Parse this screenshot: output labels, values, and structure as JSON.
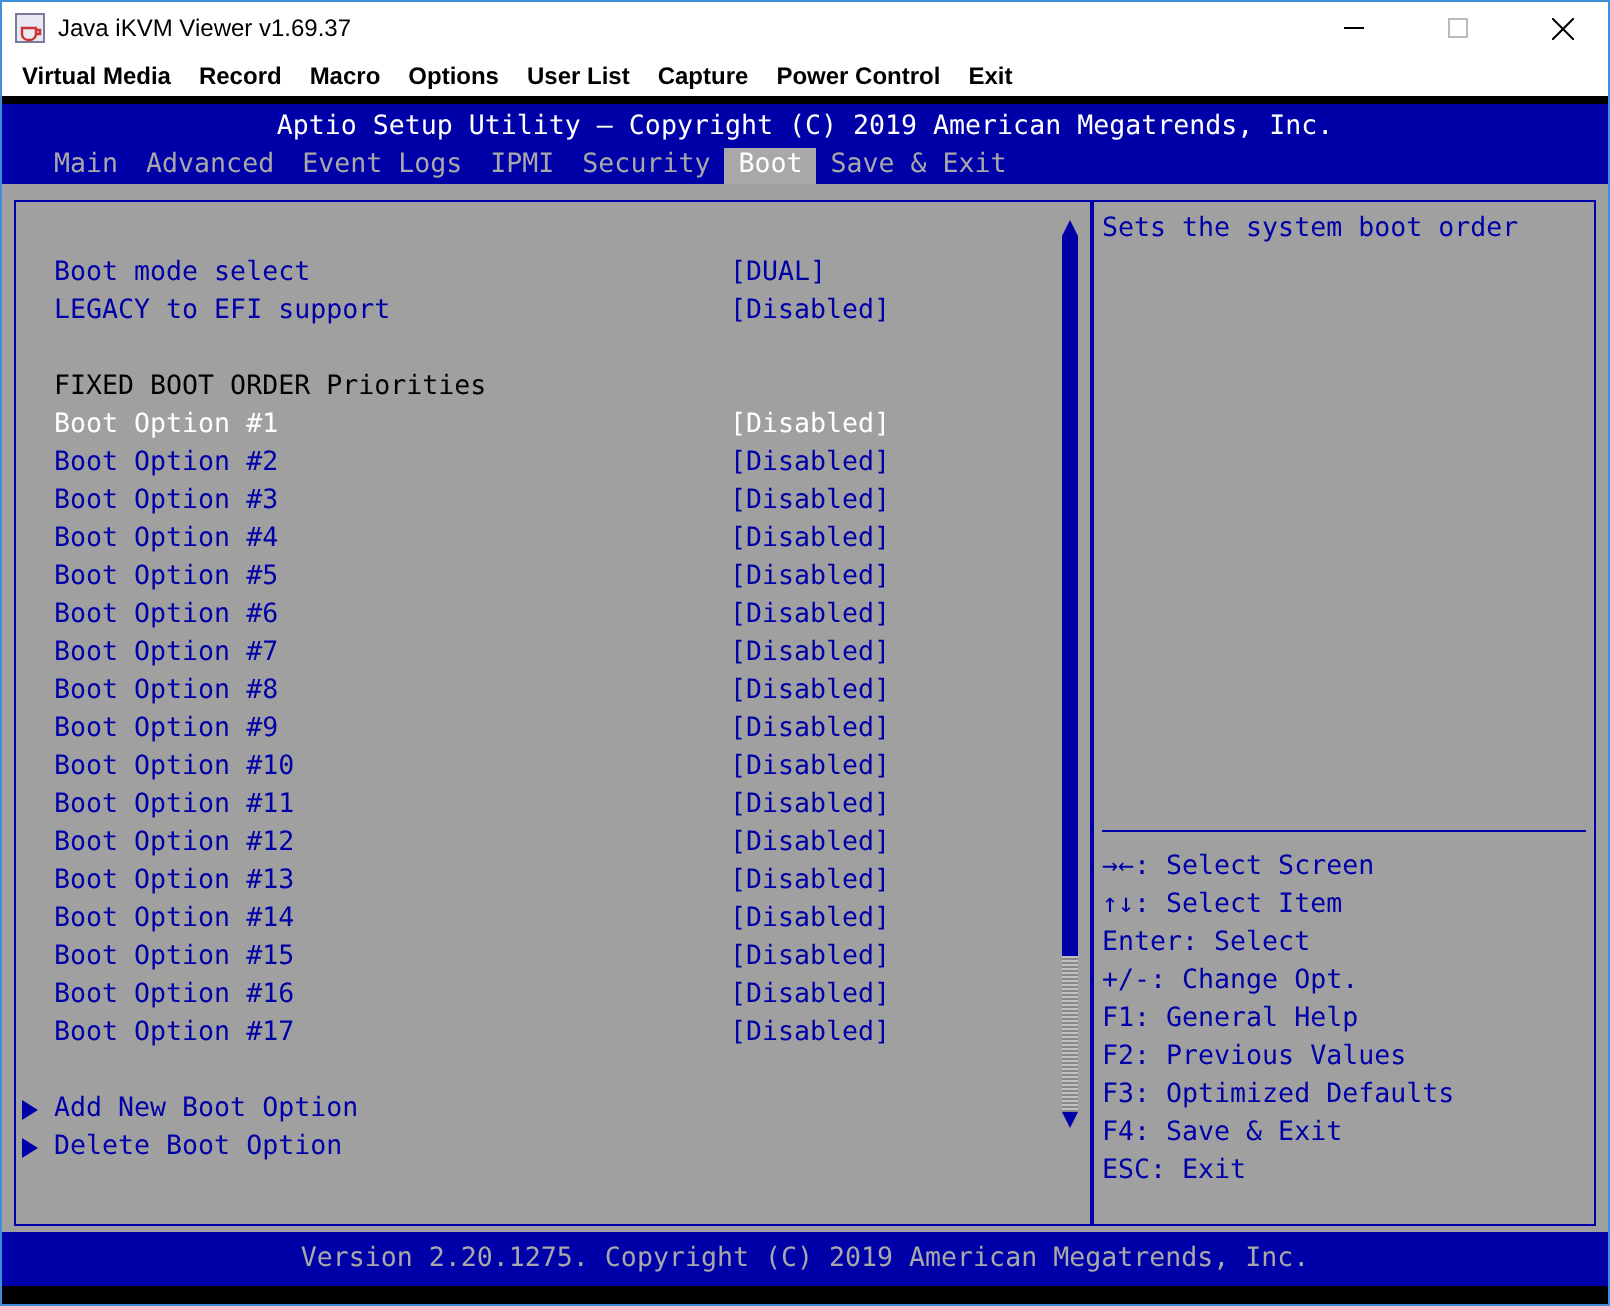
{
  "window": {
    "title": "Java iKVM Viewer v1.69.37"
  },
  "menu": [
    "Virtual Media",
    "Record",
    "Macro",
    "Options",
    "User List",
    "Capture",
    "Power Control",
    "Exit"
  ],
  "bios": {
    "title": "Aptio Setup Utility – Copyright (C) 2019 American Megatrends, Inc.",
    "tabs": [
      {
        "label": "Main",
        "selected": false
      },
      {
        "label": "Advanced",
        "selected": false
      },
      {
        "label": "Event Logs",
        "selected": false
      },
      {
        "label": "IPMI",
        "selected": false
      },
      {
        "label": "Security",
        "selected": false
      },
      {
        "label": "Boot",
        "selected": true
      },
      {
        "label": "Save & Exit",
        "selected": false
      }
    ],
    "items": [
      {
        "kind": "setting",
        "label": "Boot mode select",
        "value": "[DUAL]",
        "selected": false
      },
      {
        "kind": "setting",
        "label": "LEGACY to EFI support",
        "value": "[Disabled]",
        "selected": false
      },
      {
        "kind": "blank"
      },
      {
        "kind": "heading",
        "label": "FIXED BOOT ORDER Priorities"
      },
      {
        "kind": "setting",
        "label": "Boot Option #1",
        "value": "[Disabled]",
        "selected": true
      },
      {
        "kind": "setting",
        "label": "Boot Option #2",
        "value": "[Disabled]",
        "selected": false
      },
      {
        "kind": "setting",
        "label": "Boot Option #3",
        "value": "[Disabled]",
        "selected": false
      },
      {
        "kind": "setting",
        "label": "Boot Option #4",
        "value": "[Disabled]",
        "selected": false
      },
      {
        "kind": "setting",
        "label": "Boot Option #5",
        "value": "[Disabled]",
        "selected": false
      },
      {
        "kind": "setting",
        "label": "Boot Option #6",
        "value": "[Disabled]",
        "selected": false
      },
      {
        "kind": "setting",
        "label": "Boot Option #7",
        "value": "[Disabled]",
        "selected": false
      },
      {
        "kind": "setting",
        "label": "Boot Option #8",
        "value": "[Disabled]",
        "selected": false
      },
      {
        "kind": "setting",
        "label": "Boot Option #9",
        "value": "[Disabled]",
        "selected": false
      },
      {
        "kind": "setting",
        "label": "Boot Option #10",
        "value": "[Disabled]",
        "selected": false
      },
      {
        "kind": "setting",
        "label": "Boot Option #11",
        "value": "[Disabled]",
        "selected": false
      },
      {
        "kind": "setting",
        "label": "Boot Option #12",
        "value": "[Disabled]",
        "selected": false
      },
      {
        "kind": "setting",
        "label": "Boot Option #13",
        "value": "[Disabled]",
        "selected": false
      },
      {
        "kind": "setting",
        "label": "Boot Option #14",
        "value": "[Disabled]",
        "selected": false
      },
      {
        "kind": "setting",
        "label": "Boot Option #15",
        "value": "[Disabled]",
        "selected": false
      },
      {
        "kind": "setting",
        "label": "Boot Option #16",
        "value": "[Disabled]",
        "selected": false
      },
      {
        "kind": "setting",
        "label": "Boot Option #17",
        "value": "[Disabled]",
        "selected": false
      },
      {
        "kind": "blank"
      },
      {
        "kind": "submenu",
        "label": "Add New Boot Option",
        "selected": false
      },
      {
        "kind": "submenu",
        "label": "Delete Boot Option",
        "selected": false
      }
    ],
    "help": "Sets the system boot order",
    "keys": [
      "→←: Select Screen",
      "↑↓: Select Item",
      "Enter: Select",
      "+/-: Change Opt.",
      "F1: General Help",
      "F2: Previous Values",
      "F3: Optimized Defaults",
      "F4: Save & Exit",
      "ESC: Exit"
    ],
    "footer": "Version 2.20.1275. Copyright (C) 2019 American Megatrends, Inc."
  }
}
